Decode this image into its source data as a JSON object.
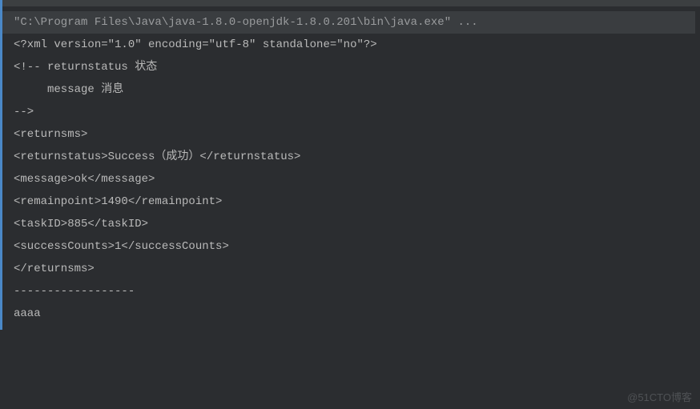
{
  "console": {
    "command": "\"C:\\Program Files\\Java\\java-1.8.0-openjdk-1.8.0.201\\bin\\java.exe\" ...",
    "lines": [
      "<?xml version=\"1.0\" encoding=\"utf-8\" standalone=\"no\"?>",
      "<!-- returnstatus 状态",
      "     message 消息",
      "-->",
      "",
      "<returnsms>",
      "<returnstatus>Success（成功）</returnstatus>",
      "<message>ok</message>",
      "<remainpoint>1490</remainpoint>",
      "<taskID>885</taskID>",
      "<successCounts>1</successCounts>",
      "</returnsms>",
      "",
      "------------------",
      "aaaa"
    ]
  },
  "watermark": "@51CTO博客"
}
